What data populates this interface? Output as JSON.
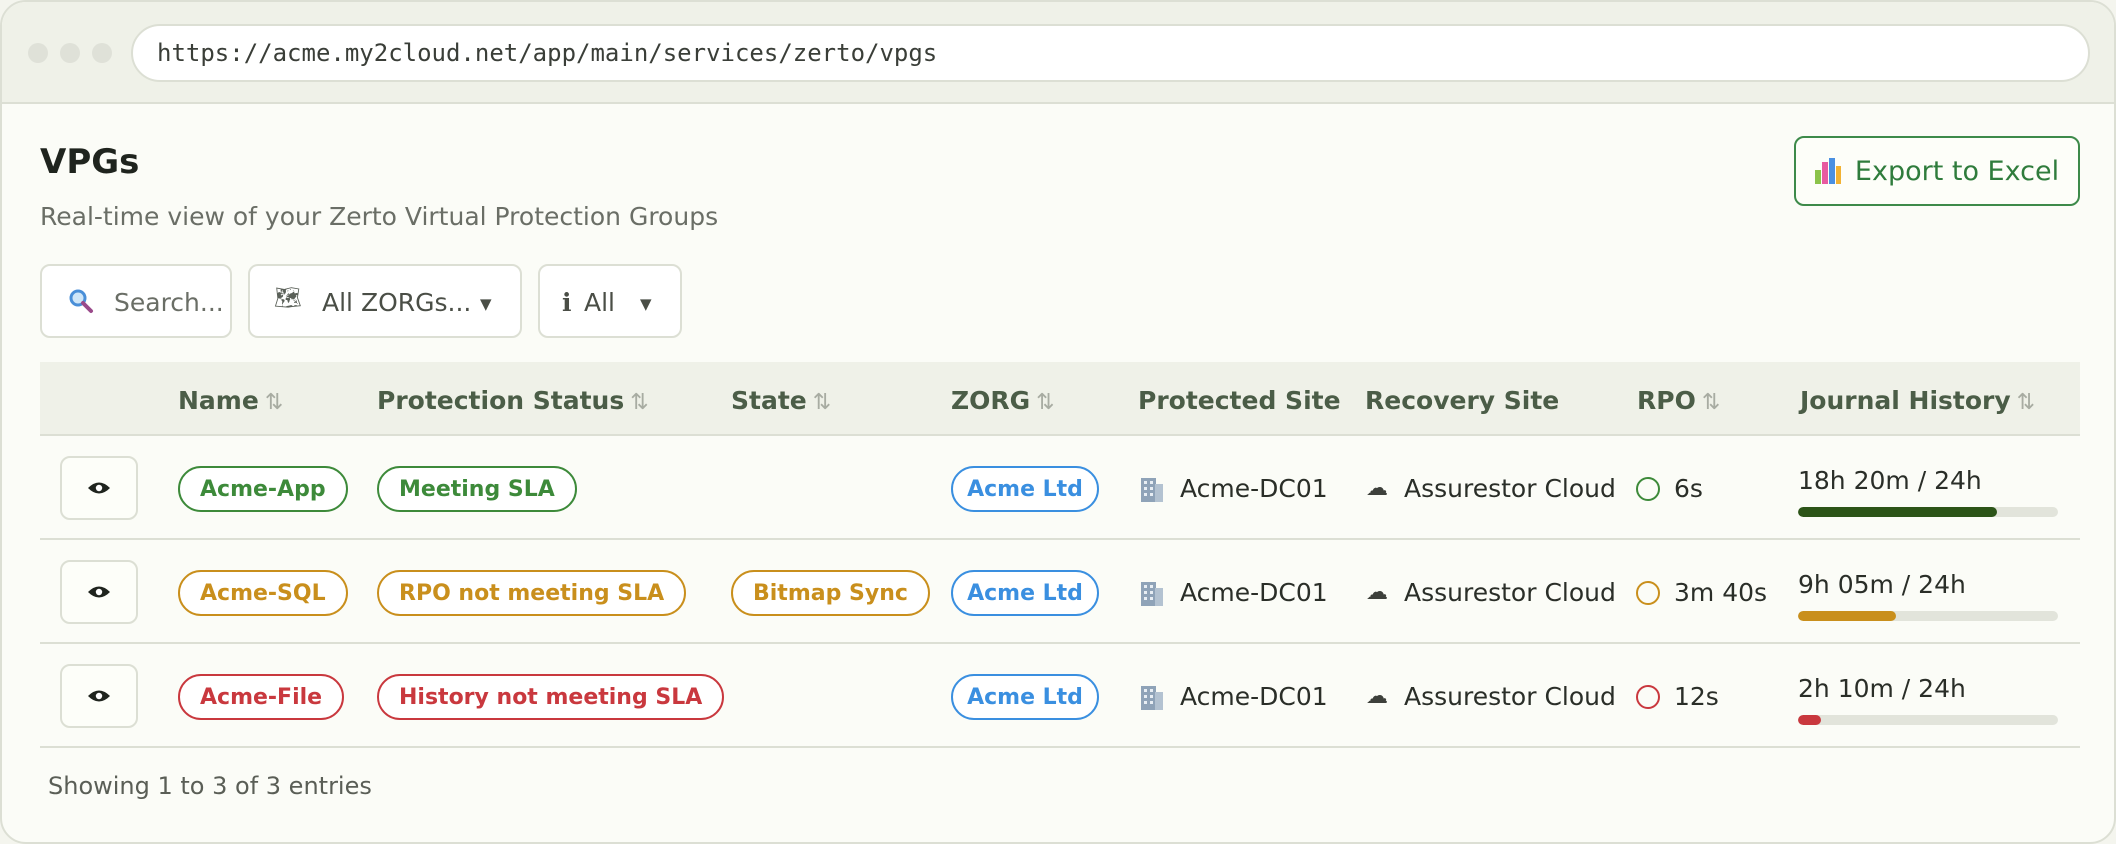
{
  "browser": {
    "url": "https://acme.my2cloud.net/app/main/services/zerto/vpgs"
  },
  "page": {
    "title": "VPGs",
    "subtitle": "Real-time view of your Zerto Virtual Protection Groups",
    "export_label": "Export to Excel"
  },
  "filters": {
    "search_placeholder": "Search...",
    "zorg_value": "All ZORGs...",
    "status_value": "All"
  },
  "table": {
    "headers": {
      "name": "Name",
      "protection_status": "Protection Status",
      "state": "State",
      "zorg": "ZORG",
      "protected_site": "Protected Site",
      "recovery_site": "Recovery Site",
      "rpo": "RPO",
      "journal_history": "Journal History"
    },
    "rows": [
      {
        "name": "Acme-App",
        "status": "Meeting SLA",
        "state": "",
        "zorg": "Acme Ltd",
        "protected_site": "Acme-DC01",
        "recovery_site": "Assurestor Cloud",
        "rpo": "6s",
        "journal": "18h 20m / 24h",
        "journal_fraction": 0.764,
        "color": "#3d8a3a",
        "fill_color": "#2c5418"
      },
      {
        "name": "Acme-SQL",
        "status": "RPO not meeting SLA",
        "state": "Bitmap Sync",
        "zorg": "Acme Ltd",
        "protected_site": "Acme-DC01",
        "recovery_site": "Assurestor Cloud",
        "rpo": "3m 40s",
        "journal": "9h 05m / 24h",
        "journal_fraction": 0.378,
        "color": "#c98f1c",
        "fill_color": "#c98f1c"
      },
      {
        "name": "Acme-File",
        "status": "History not meeting SLA",
        "state": "",
        "zorg": "Acme Ltd",
        "protected_site": "Acme-DC01",
        "recovery_site": "Assurestor Cloud",
        "rpo": "12s",
        "journal": "2h 10m / 24h",
        "journal_fraction": 0.09,
        "color": "#c9383e",
        "fill_color": "#c9383e"
      }
    ]
  },
  "colors": {
    "accent": "#2f7c3c",
    "zorg": "#3a8fe0"
  },
  "footer": {
    "summary": "Showing 1 to 3 of 3 entries"
  }
}
